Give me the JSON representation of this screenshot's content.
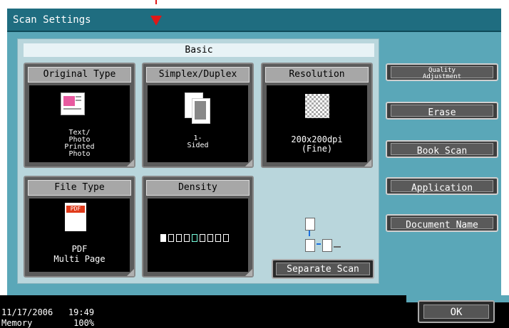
{
  "title": "Scan Settings",
  "basic_label": "Basic",
  "tiles": {
    "original_type": {
      "label": "Original Type",
      "value": "Text/\nPhoto\nPrinted\nPhoto"
    },
    "simplex_duplex": {
      "label": "Simplex/Duplex",
      "value": "1-\nSided"
    },
    "resolution": {
      "label": "Resolution",
      "value": "200x200dpi\n(Fine)"
    },
    "file_type": {
      "label": "File Type",
      "icon_text": "PDF",
      "value": "PDF\nMulti Page"
    },
    "density": {
      "label": "Density",
      "level": 5,
      "levels": 9
    }
  },
  "separate_scan_label": "Separate Scan",
  "side_buttons": {
    "quality_adjustment": "Quality\nAdjustment",
    "erase": "Erase",
    "book_scan": "Book Scan",
    "application": "Application",
    "document_name": "Document Name"
  },
  "status": {
    "datetime": "11/17/2006   19:49",
    "memory": "Memory        100%"
  },
  "ok_label": "OK",
  "colors": {
    "frame": "#5aa7b8",
    "titlebar": "#1f6d80",
    "arrow": "#e01818"
  }
}
